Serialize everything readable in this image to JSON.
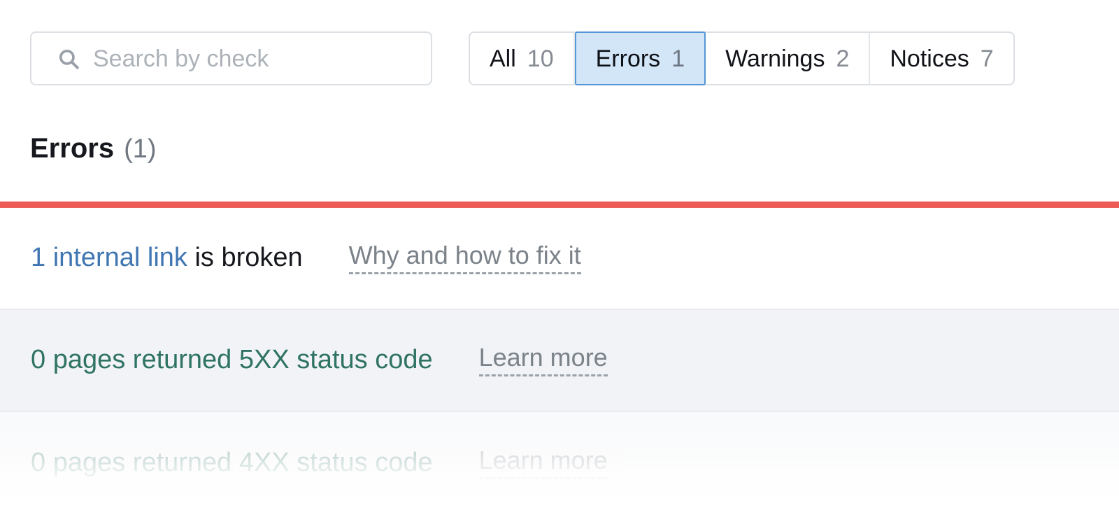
{
  "search": {
    "placeholder": "Search by check",
    "value": "",
    "icon": "search-icon"
  },
  "tabs": [
    {
      "label": "All",
      "count": "10",
      "active": false
    },
    {
      "label": "Errors",
      "count": "1",
      "active": true
    },
    {
      "label": "Warnings",
      "count": "2",
      "active": false
    },
    {
      "label": "Notices",
      "count": "7",
      "active": false
    }
  ],
  "section": {
    "title": "Errors",
    "count": "(1)",
    "severity_color": "#ec5b55"
  },
  "checks": [
    {
      "link_text": "1 internal link",
      "rest_text": " is broken",
      "help_label": "Why and how to fix it",
      "state": "error"
    },
    {
      "text": "0 pages returned 5XX status code",
      "help_label": "Learn more",
      "state": "ok"
    },
    {
      "text": "0 pages returned 4XX status code",
      "help_label": "Learn more",
      "state": "ok"
    }
  ],
  "colors": {
    "error_bar": "#ec5b55",
    "link_blue": "#4076b1",
    "ok_green": "#2f7364",
    "tab_active_bg": "#d3e6f8",
    "tab_active_border": "#5596d6",
    "row_alt_bg": "#f1f3f6"
  }
}
